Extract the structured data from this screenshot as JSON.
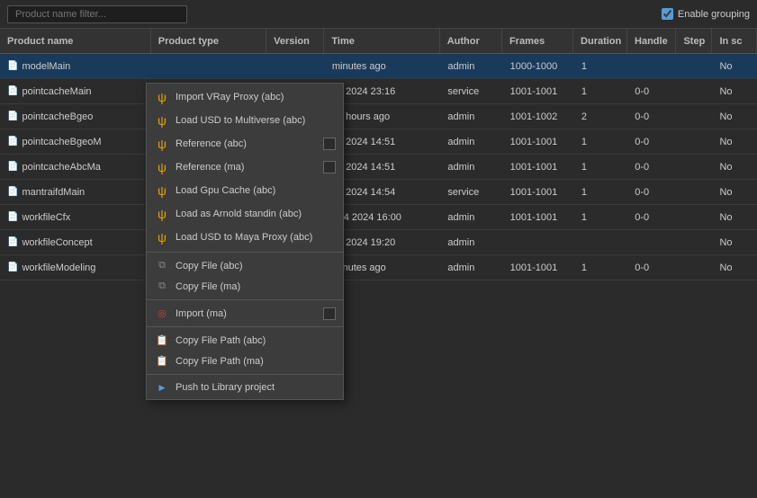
{
  "topbar": {
    "search_placeholder": "Product name filter...",
    "enable_grouping_label": "Enable grouping",
    "enable_grouping_checked": true
  },
  "table": {
    "headers": {
      "product_name": "Product name",
      "product_type": "Product type",
      "version": "Version",
      "time": "Time",
      "author": "Author",
      "frames": "Frames",
      "duration": "Duration",
      "handle": "Handle",
      "step": "Step",
      "in_sc": "In sc"
    },
    "rows": [
      {
        "id": 0,
        "product_name": "modelMain",
        "product_type": "",
        "version": "",
        "time": "minutes ago",
        "author": "admin",
        "frames": "1000-1000",
        "duration": "1",
        "handle": "",
        "step": "",
        "in_sc": "No",
        "selected": true
      },
      {
        "id": 1,
        "product_name": "pointcacheMain",
        "product_type": "",
        "version": "",
        "time": "29 2024 23:16",
        "author": "service",
        "frames": "1001-1001",
        "duration": "1",
        "handle": "0-0",
        "step": "",
        "in_sc": "No",
        "selected": false
      },
      {
        "id": 2,
        "product_name": "pointcacheBgeo",
        "product_type": "",
        "version": "",
        "time": "56 hours ago",
        "author": "admin",
        "frames": "1001-1002",
        "duration": "2",
        "handle": "0-0",
        "step": "",
        "in_sc": "No",
        "selected": false
      },
      {
        "id": 3,
        "product_name": "pointcacheBgeoM",
        "product_type": "",
        "version": "",
        "time": "26 2024 14:51",
        "author": "admin",
        "frames": "1001-1001",
        "duration": "1",
        "handle": "0-0",
        "step": "",
        "in_sc": "No",
        "selected": false
      },
      {
        "id": 4,
        "product_name": "pointcacheAbcMa",
        "product_type": "",
        "version": "",
        "time": "26 2024 14:51",
        "author": "admin",
        "frames": "1001-1001",
        "duration": "1",
        "handle": "0-0",
        "step": "",
        "in_sc": "No",
        "selected": false
      },
      {
        "id": 5,
        "product_name": "mantraifdMain",
        "product_type": "",
        "version": "",
        "time": "26 2024 14:54",
        "author": "service",
        "frames": "1001-1001",
        "duration": "1",
        "handle": "0-0",
        "step": "",
        "in_sc": "No",
        "selected": false
      },
      {
        "id": 6,
        "product_name": "workfileCfx",
        "product_type": "",
        "version": "",
        "time": "r 04 2024 16:00",
        "author": "admin",
        "frames": "1001-1001",
        "duration": "1",
        "handle": "0-0",
        "step": "",
        "in_sc": "No",
        "selected": false
      },
      {
        "id": 7,
        "product_name": "workfileConcept",
        "product_type": "",
        "version": "",
        "time": "16 2024 19:20",
        "author": "admin",
        "frames": "",
        "duration": "",
        "handle": "",
        "step": "",
        "in_sc": "No",
        "selected": false
      },
      {
        "id": 8,
        "product_name": "workfileModeling",
        "product_type": "",
        "version": "",
        "time": "minutes ago",
        "author": "admin",
        "frames": "1001-1001",
        "duration": "1",
        "handle": "0-0",
        "step": "",
        "in_sc": "No",
        "selected": false
      }
    ]
  },
  "context_menu": {
    "items": [
      {
        "id": "import-vray-proxy-abc",
        "icon": "ψ",
        "icon_type": "yellow",
        "label": "Import VRay Proxy (abc)",
        "has_checkbox": false
      },
      {
        "id": "load-usd-multiverse-abc",
        "icon": "ψ",
        "icon_type": "yellow",
        "label": "Load USD to Multiverse (abc)",
        "has_checkbox": false
      },
      {
        "id": "reference-abc",
        "icon": "ψ",
        "icon_type": "yellow",
        "label": "Reference (abc)",
        "has_checkbox": true
      },
      {
        "id": "reference-ma",
        "icon": "ψ",
        "icon_type": "yellow",
        "label": "Reference (ma)",
        "has_checkbox": true
      },
      {
        "id": "load-gpu-cache-abc",
        "icon": "ψ",
        "icon_type": "yellow",
        "label": "Load Gpu Cache (abc)",
        "has_checkbox": false
      },
      {
        "id": "load-arnold-standin-abc",
        "icon": "ψ",
        "icon_type": "yellow",
        "label": "Load as Arnold standin (abc)",
        "has_checkbox": false
      },
      {
        "id": "load-usd-maya-proxy-abc",
        "icon": "ψ",
        "icon_type": "yellow",
        "label": "Load USD to Maya Proxy (abc)",
        "has_checkbox": false
      },
      {
        "id": "copy-file-abc",
        "icon": "⧉",
        "icon_type": "gray",
        "label": "Copy File (abc)",
        "has_checkbox": false
      },
      {
        "id": "copy-file-ma",
        "icon": "⧉",
        "icon_type": "gray",
        "label": "Copy File (ma)",
        "has_checkbox": false
      },
      {
        "id": "import-ma",
        "icon": "◎",
        "icon_type": "red",
        "label": "Import (ma)",
        "has_checkbox": true
      },
      {
        "id": "copy-file-path-abc",
        "icon": "📋",
        "icon_type": "gray",
        "label": "Copy File Path (abc)",
        "has_checkbox": false
      },
      {
        "id": "copy-file-path-ma",
        "icon": "📋",
        "icon_type": "gray",
        "label": "Copy File Path (ma)",
        "has_checkbox": false
      },
      {
        "id": "push-library-project",
        "icon": "▶",
        "icon_type": "blue",
        "label": "Push to Library project",
        "has_checkbox": false
      }
    ]
  }
}
